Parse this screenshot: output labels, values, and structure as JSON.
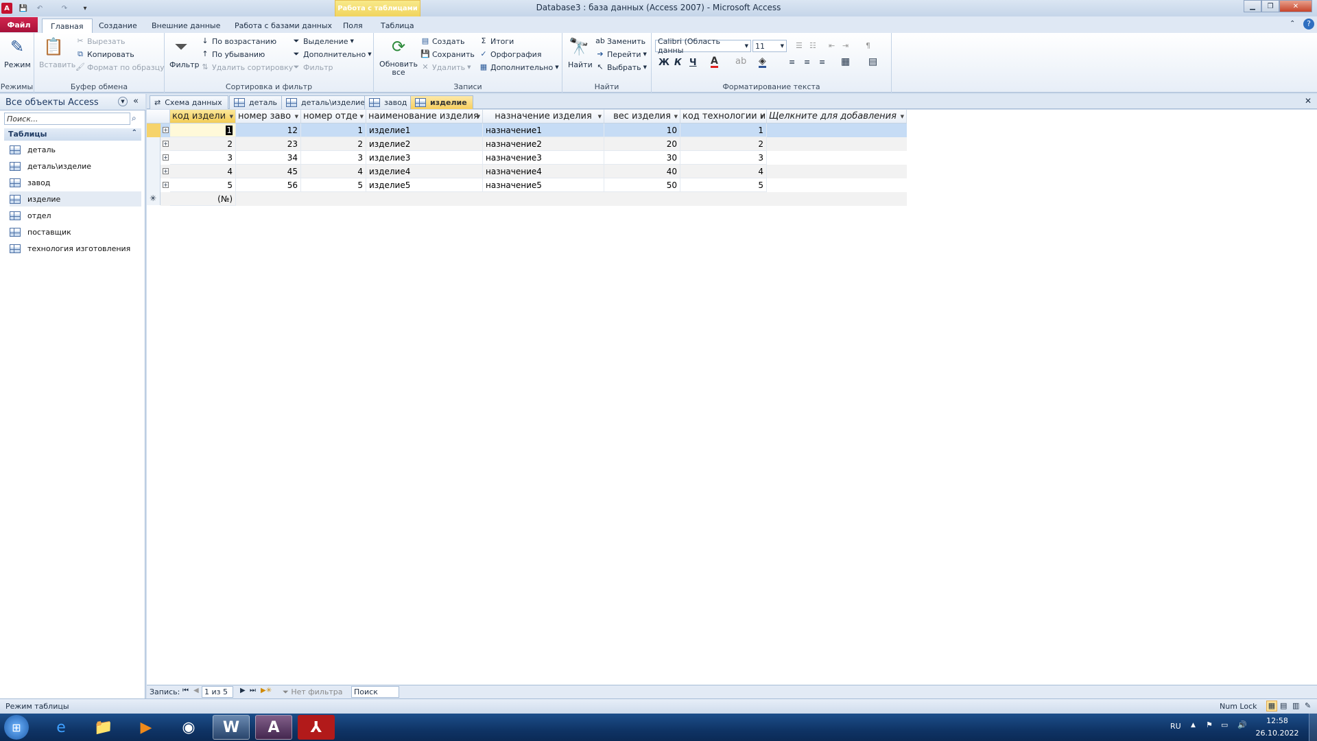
{
  "window": {
    "title": "Database3 : база данных (Access 2007) - Microsoft Access",
    "context_tab_header": "Работа с таблицами",
    "app_icon": "A"
  },
  "ribbon_tabs": [
    "Главная",
    "Создание",
    "Внешние данные",
    "Работа с базами данных",
    "Поля",
    "Таблица"
  ],
  "file_tab": "Файл",
  "ribbon": {
    "modes": {
      "label": "Режимы",
      "view": "Режим"
    },
    "clipboard": {
      "label": "Буфер обмена",
      "paste": "Вставить",
      "cut": "Вырезать",
      "copy": "Копировать",
      "format_painter": "Формат по образцу"
    },
    "sort": {
      "label": "Сортировка и фильтр",
      "filter": "Фильтр",
      "asc": "По возрастанию",
      "desc": "По убыванию",
      "clear": "Удалить сортировку",
      "selection": "Выделение",
      "advanced": "Дополнительно",
      "toggle": "Фильтр"
    },
    "records": {
      "label": "Записи",
      "refresh": "Обновить все",
      "new": "Создать",
      "save": "Сохранить",
      "delete": "Удалить",
      "totals": "Итоги",
      "spelling": "Орфография",
      "more": "Дополнительно"
    },
    "find": {
      "label": "Найти",
      "find": "Найти",
      "replace": "Заменить",
      "goto": "Перейти",
      "select": "Выбрать"
    },
    "text": {
      "label": "Форматирование текста",
      "font": "Calibri (Область данны",
      "size": "11",
      "bold": "Ж",
      "italic": "К",
      "underline": "Ч"
    }
  },
  "nav": {
    "header": "Все объекты Access",
    "search_placeholder": "Поиск...",
    "group": "Таблицы",
    "items": [
      "деталь",
      "деталь\\изделие",
      "завод",
      "изделие",
      "отдел",
      "поставщик",
      "технология изготовления"
    ]
  },
  "doc_tabs": [
    "Схема данных",
    "деталь",
    "деталь\\изделие",
    "завод",
    "изделие"
  ],
  "table": {
    "columns": [
      "код издели",
      "номер заво",
      "номер отде",
      "наименование изделия",
      "назначение изделия",
      "вес изделия",
      "код технологии и",
      "Щелкните для добавления"
    ],
    "rows": [
      [
        "1",
        "12",
        "1",
        "изделие1",
        "назначение1",
        "10",
        "1"
      ],
      [
        "2",
        "23",
        "2",
        "изделие2",
        "назначение2",
        "20",
        "2"
      ],
      [
        "3",
        "34",
        "3",
        "изделие3",
        "назначение3",
        "30",
        "3"
      ],
      [
        "4",
        "45",
        "4",
        "изделие4",
        "назначение4",
        "40",
        "4"
      ],
      [
        "5",
        "56",
        "5",
        "изделие5",
        "назначение5",
        "50",
        "5"
      ]
    ],
    "new_row_marker": "(№)"
  },
  "record_nav": {
    "label": "Запись:",
    "position": "1 из 5",
    "filter": "Нет фильтра",
    "search": "Поиск"
  },
  "status": {
    "left": "Режим таблицы",
    "numlock": "Num Lock"
  },
  "taskbar": {
    "lang": "RU",
    "time": "12:58",
    "date": "26.10.2022"
  }
}
